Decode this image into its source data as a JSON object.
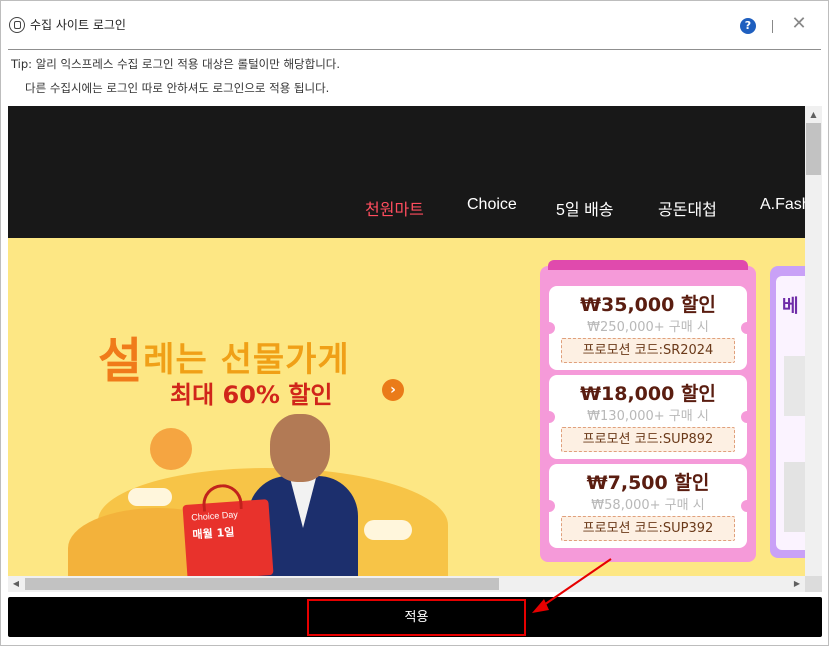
{
  "window": {
    "title": "수집 사이트 로그인",
    "help_label": "?",
    "close_label": "✕"
  },
  "tip": {
    "line1": "Tip: 알리 익스프레스 수집 로그인 적용 대상은 롤털이만 해당합니다.",
    "line2": "다른 수집시에는 로그인 따로 안하셔도 로그인으로 적용 됩니다."
  },
  "site": {
    "nav": [
      "천원마트",
      "Choice",
      "5일 배송",
      "공돈대첩",
      "A.Fash"
    ],
    "active_nav": "천원마트",
    "banner": {
      "headline_first": "설",
      "headline_rest": "레는 선물가게",
      "subheadline": "최대 60% 할인",
      "arrow": "›",
      "bag_line1": "Choice Day",
      "bag_line2": "매월 1일"
    },
    "coupons": [
      {
        "amount": "₩35,000 할인",
        "condition": "₩250,000+ 구매 시",
        "code": "프로모션 코드:SR2024"
      },
      {
        "amount": "₩18,000 할인",
        "condition": "₩130,000+ 구매 시",
        "code": "프로모션 코드:SUP892"
      },
      {
        "amount": "₩7,500 할인",
        "condition": "₩58,000+ 구매 시",
        "code": "프로모션 코드:SUP392"
      }
    ],
    "side_panel_text": "베"
  },
  "footer": {
    "apply_label": "적용"
  },
  "colors": {
    "nav_bg": "#181818",
    "nav_active": "#ff4d5e",
    "banner_bg": "#fde784",
    "coupon_panel": "#f59ad9",
    "apply_bar": "#000000",
    "highlight_border": "#e60000"
  }
}
